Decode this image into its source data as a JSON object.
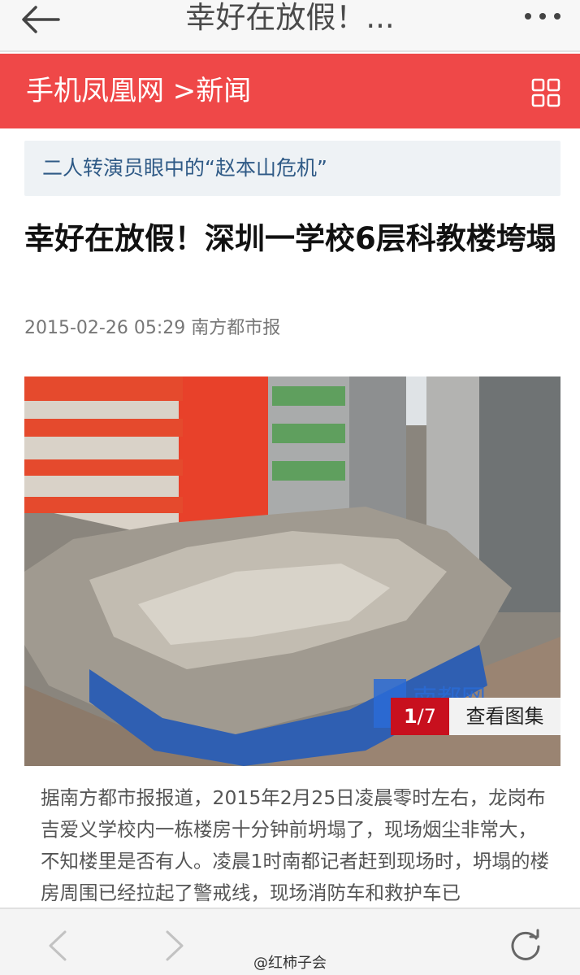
{
  "browser": {
    "title": "幸好在放假！...",
    "back_icon": "back-arrow-icon",
    "more_icon": "more-dots-icon"
  },
  "site_header": {
    "brand": "手机凤凰网 >新闻",
    "background": "#ef4848",
    "menu_icon": "grid-menu-icon"
  },
  "promo": {
    "text": "二人转演员眼中的“赵本山危机”"
  },
  "article": {
    "headline": "幸好在放假！深圳一学校6层科教楼垮塌",
    "meta": "2015-02-26 05:29 南方都市报",
    "photo": {
      "counter_current": "1",
      "counter_total": "/7",
      "gallery_label": "查看图集",
      "image_watermark": "南都网"
    },
    "body": "据南方都市报报道，2015年2月25日凌晨零时左右，龙岗布吉爱义学校内一栋楼房十分钟前坍塌了，现场烟尘非常大，不知楼里是否有人。凌晨1时南都记者赶到现场时，坍塌的楼房周围已经拉起了警戒线，现场消防车和救护车已"
  },
  "bottom_nav": {
    "prev_icon": "chevron-left-icon",
    "next_icon": "chevron-right-icon",
    "refresh_icon": "refresh-icon",
    "watermark": "@红柿子会"
  }
}
